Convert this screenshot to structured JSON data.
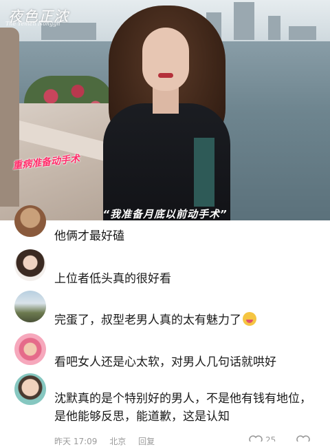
{
  "video": {
    "logo": "夜色正浓",
    "logo_sub": "The Yemen Nonggh",
    "tag": "重病准备动手术",
    "subtitle": "“我准备月底以前动手术”"
  },
  "comments": [
    {
      "text": "他俩才最好磕",
      "avatar": "avatar-brown"
    },
    {
      "text": "上位者低头真的很好看",
      "avatar": "avatar-woman"
    },
    {
      "text": "完蛋了，叔型老男人真的太有魅力了",
      "avatar": "avatar-outdoor",
      "emoji": "drooling-face-icon"
    },
    {
      "text": "看吧女人还是心太软，对男人几句话就哄好",
      "avatar": "avatar-flower"
    },
    {
      "text": "沈默真的是个特别好的男人，不是他有钱有地位，是他能够反思，能道歉，这是认知",
      "avatar": "avatar-child"
    }
  ],
  "footer": {
    "time": "昨天 17:09",
    "location": "北京",
    "reply": "回复",
    "likes": "25"
  }
}
